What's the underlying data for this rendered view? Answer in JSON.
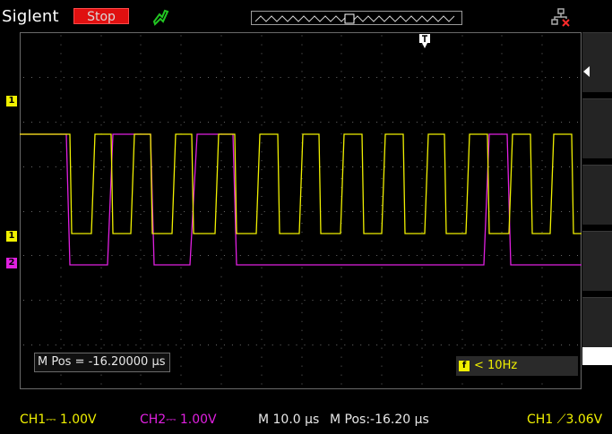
{
  "header": {
    "brand": "Siglent",
    "run_state": "Stop"
  },
  "markers": {
    "ch1": "1",
    "ch2": "2",
    "trigger_top": "T",
    "trigger_level_side": "1"
  },
  "readouts": {
    "mpos_box": "M Pos = -16.20000 µs",
    "trigger_freq": "< 10Hz",
    "trigger_icon": "f"
  },
  "status": {
    "ch1": "CH1⎓ 1.00V",
    "ch2": "CH2⎓ 1.00V",
    "timebase": "M 10.0 µs",
    "mpos": "M Pos:-16.20 µs",
    "trigger": "CH1 ⟋3.06V"
  },
  "colors": {
    "ch1": "#f0f000",
    "ch2": "#e020e0",
    "run_state_bg": "#e01010",
    "grid": "#555555",
    "probe_icon": "#22c522"
  },
  "icons": {
    "probe": "probe-icon",
    "network": "network-disconnected-icon",
    "menu_arrow": "triangle-left-icon"
  }
}
